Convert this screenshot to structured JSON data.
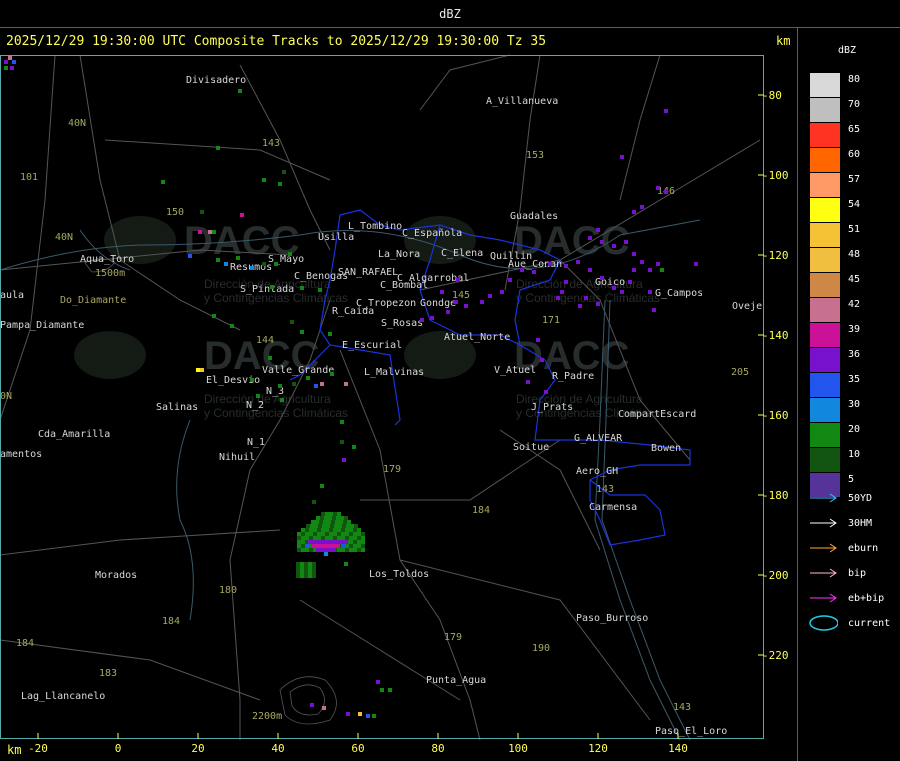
{
  "window_title": "dBZ",
  "header": "2025/12/29 19:30:00 UTC Composite Tracks to 2025/12/29 19:30:00 Tz 35",
  "axis_unit": "km",
  "legend": {
    "unit": "dBZ",
    "levels": [
      {
        "label": "80",
        "color": "#d9d9d9"
      },
      {
        "label": "70",
        "color": "#bfbfbf"
      },
      {
        "label": "65",
        "color": "#ff3322"
      },
      {
        "label": "60",
        "color": "#ff6600"
      },
      {
        "label": "57",
        "color": "#ff9a66"
      },
      {
        "label": "54",
        "color": "#ffff11"
      },
      {
        "label": "51",
        "color": "#f6c235"
      },
      {
        "label": "48",
        "color": "#f1bf40"
      },
      {
        "label": "45",
        "color": "#cc8844"
      },
      {
        "label": "42",
        "color": "#c87090"
      },
      {
        "label": "39",
        "color": "#cc1199"
      },
      {
        "label": "36",
        "color": "#7711cc"
      },
      {
        "label": "35",
        "color": "#2255ee"
      },
      {
        "label": "30",
        "color": "#1188dd"
      },
      {
        "label": "20",
        "color": "#118811"
      },
      {
        "label": "10",
        "color": "#115511"
      },
      {
        "label": "5",
        "color": "#553399"
      }
    ],
    "tracks": [
      {
        "label": "50YD",
        "color": "#22ccee",
        "type": "arrow"
      },
      {
        "label": "30HM",
        "color": "#ffffff",
        "type": "arrow"
      },
      {
        "label": "eburn",
        "color": "#ffaa33",
        "type": "arrow"
      },
      {
        "label": "bip",
        "color": "#ffbbcc",
        "type": "arrow"
      },
      {
        "label": "eb+bip",
        "color": "#ff33ff",
        "type": "arrow"
      },
      {
        "label": "current",
        "color": "#22ccee",
        "type": "ellipse"
      }
    ]
  },
  "x_ticks": [
    "-20",
    "0",
    "20",
    "40",
    "60",
    "80",
    "100",
    "120",
    "140"
  ],
  "y_ticks": [
    "-80",
    "-100",
    "-120",
    "-140",
    "-160",
    "-180",
    "-200",
    "-220"
  ],
  "watermark": {
    "text": "DACC",
    "line1": "Dirección de Agricultura",
    "line2": "y Contingencias Climáticas"
  },
  "places": [
    "Divisadero",
    "A_Villanueva",
    "L_Tombino",
    "Usilla",
    "C_Española",
    "La_Nora",
    "C_Elena",
    "Aqua_Toro",
    "Resumos",
    "S_Mayo",
    "C_Benogas",
    "SAN_RAFAEL",
    "C_Algarrobal",
    "C_Bombal",
    "Quillin",
    "Aue_Conan",
    "Guadales",
    "Goico",
    "G_Campos",
    "Pampa_Diamante",
    "S_Pintada",
    "R_Caida",
    "C_Tropezon",
    "Gondge",
    "S_Rosas",
    "Atuel_Norte",
    "E_Escurial",
    "Valle_Grande",
    "L_Malvinas",
    "V_Atuel",
    "R_Padre",
    "El_Desvio",
    "Salinas",
    "N_2",
    "N_3",
    "J_Prats",
    "CompartEscard",
    "Cda_Amarilla",
    "N_1",
    "Nihuil",
    "G_ALVEAR",
    "Soitue",
    "Bowen",
    "Aero_GH",
    "Carmensa",
    "Morados",
    "Los_Toldos",
    "Paso_Burroso",
    "Punta_Agua",
    "Lag_Llancanelo",
    "Paso_El_Loro",
    "Oveje",
    "aula",
    "amentos",
    "1500m",
    "2200m",
    "Do_Diamante",
    "40N",
    "0N"
  ],
  "road_numbers": [
    "101",
    "40N",
    "150",
    "143",
    "153",
    "146",
    "144",
    "143",
    "179",
    "184",
    "180",
    "184",
    "183",
    "184",
    "179",
    "190",
    "143",
    "171",
    "205",
    "145"
  ]
}
